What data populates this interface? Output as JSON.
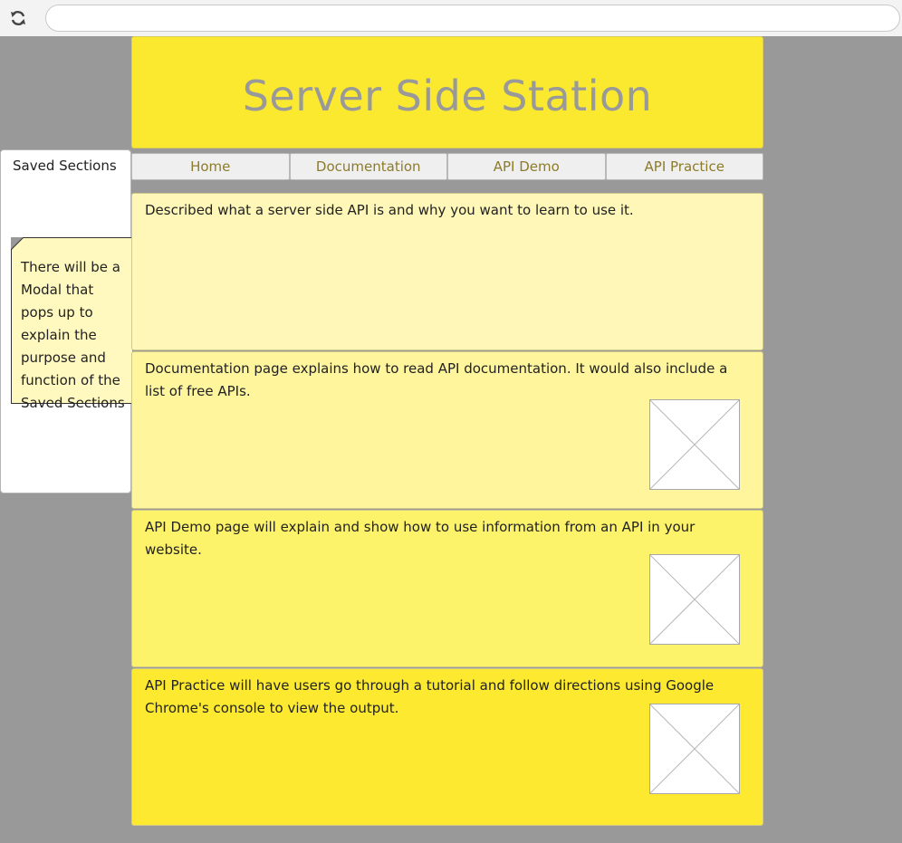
{
  "site": {
    "title": "Server Side Station"
  },
  "nav": {
    "items": [
      {
        "label": "Home"
      },
      {
        "label": "Documentation"
      },
      {
        "label": "API Demo"
      },
      {
        "label": "API Practice"
      }
    ]
  },
  "sidebar": {
    "title": "Saved Sections",
    "note": "There will be a Modal that pops up to explain the purpose and function of the Saved Sections"
  },
  "sections": [
    {
      "text": "Described what a server side API is and why you want to learn to use it."
    },
    {
      "text": "Documentation page explains how to read API documentation. It would also include a list of free APIs."
    },
    {
      "text": "API Demo page will explain and show how to use information from an API in your website."
    },
    {
      "text": "API Practice will have users go through a tutorial and follow directions using Google Chrome's console to view the output."
    }
  ],
  "icons": {
    "reload": "reload-icon",
    "placeholder": "image-placeholder-icon"
  },
  "colors": {
    "background": "#999999",
    "header": "#fbe92f",
    "title_text": "#999999",
    "nav_text": "#8c7b2a"
  }
}
